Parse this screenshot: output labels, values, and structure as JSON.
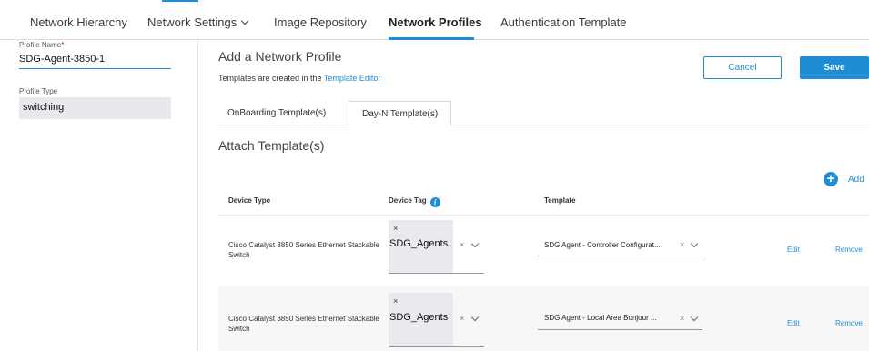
{
  "topnav": {
    "tabs": [
      {
        "label": "Network Hierarchy"
      },
      {
        "label": "Network Settings"
      },
      {
        "label": "Image Repository"
      },
      {
        "label": "Network Profiles"
      },
      {
        "label": "Authentication Template"
      }
    ],
    "active_tab": "Network Profiles"
  },
  "left": {
    "profile_name_label": "Profile Name",
    "profile_name_required": "*",
    "profile_name_value": "SDG-Agent-3850-1",
    "profile_type_label": "Profile Type",
    "profile_type_value": "switching"
  },
  "main": {
    "title": "Add a Network Profile",
    "subtitle_prefix": "Templates are created in the ",
    "subtitle_link": "Template Editor",
    "cancel_label": "Cancel",
    "save_label": "Save",
    "subtabs": [
      {
        "label": "OnBoarding Template(s)"
      },
      {
        "label": "Day-N Template(s)"
      }
    ],
    "active_subtab": "Day-N Template(s)",
    "section_title": "Attach Template(s)",
    "add_label": "Add",
    "columns": {
      "device_type": "Device Type",
      "device_tag": "Device Tag",
      "template": "Template"
    },
    "rows": [
      {
        "device_type": "Cisco Catalyst 3850 Series Ethernet Stackable Switch",
        "device_tag": "SDG_Agents",
        "template": "SDG Agent - Controller Configurat...",
        "edit": "Edit",
        "remove": "Remove"
      },
      {
        "device_type": "Cisco Catalyst 3850 Series Ethernet Stackable Switch",
        "device_tag": "SDG_Agents",
        "template": "SDG Agent - Local Area Bonjour ...",
        "edit": "Edit",
        "remove": "Remove"
      }
    ]
  },
  "colors": {
    "accent": "#1f8dd6",
    "required": "#d0021b",
    "select_bg": "#e7e9ee"
  },
  "icons": {
    "chevron": "chevron-down-icon",
    "info": "info-icon",
    "add": "plus-circle-icon",
    "clear": "close-icon"
  }
}
